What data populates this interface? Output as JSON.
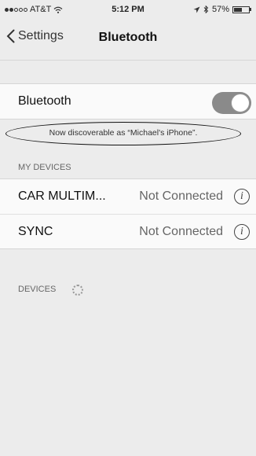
{
  "status": {
    "carrier": "AT&T",
    "time": "5:12 PM",
    "battery": "57%",
    "battery_level": 0.57
  },
  "nav": {
    "back_label": "Settings",
    "title": "Bluetooth"
  },
  "bluetooth_toggle": {
    "label": "Bluetooth",
    "on": true
  },
  "discoverable": "Now discoverable as “Michael's iPhone”.",
  "my_devices": {
    "header": "MY DEVICES",
    "items": [
      {
        "name": "CAR MULTIM...",
        "status": "Not Connected"
      },
      {
        "name": "SYNC",
        "status": "Not Connected"
      }
    ]
  },
  "devices": {
    "header": "DEVICES"
  },
  "icons": {
    "back": "chevron-left-icon",
    "info": "info-icon",
    "wifi": "wifi-icon",
    "location": "location-arrow-icon",
    "bluetooth": "bluetooth-icon",
    "battery": "battery-icon",
    "spinner": "activity-spinner-icon"
  }
}
